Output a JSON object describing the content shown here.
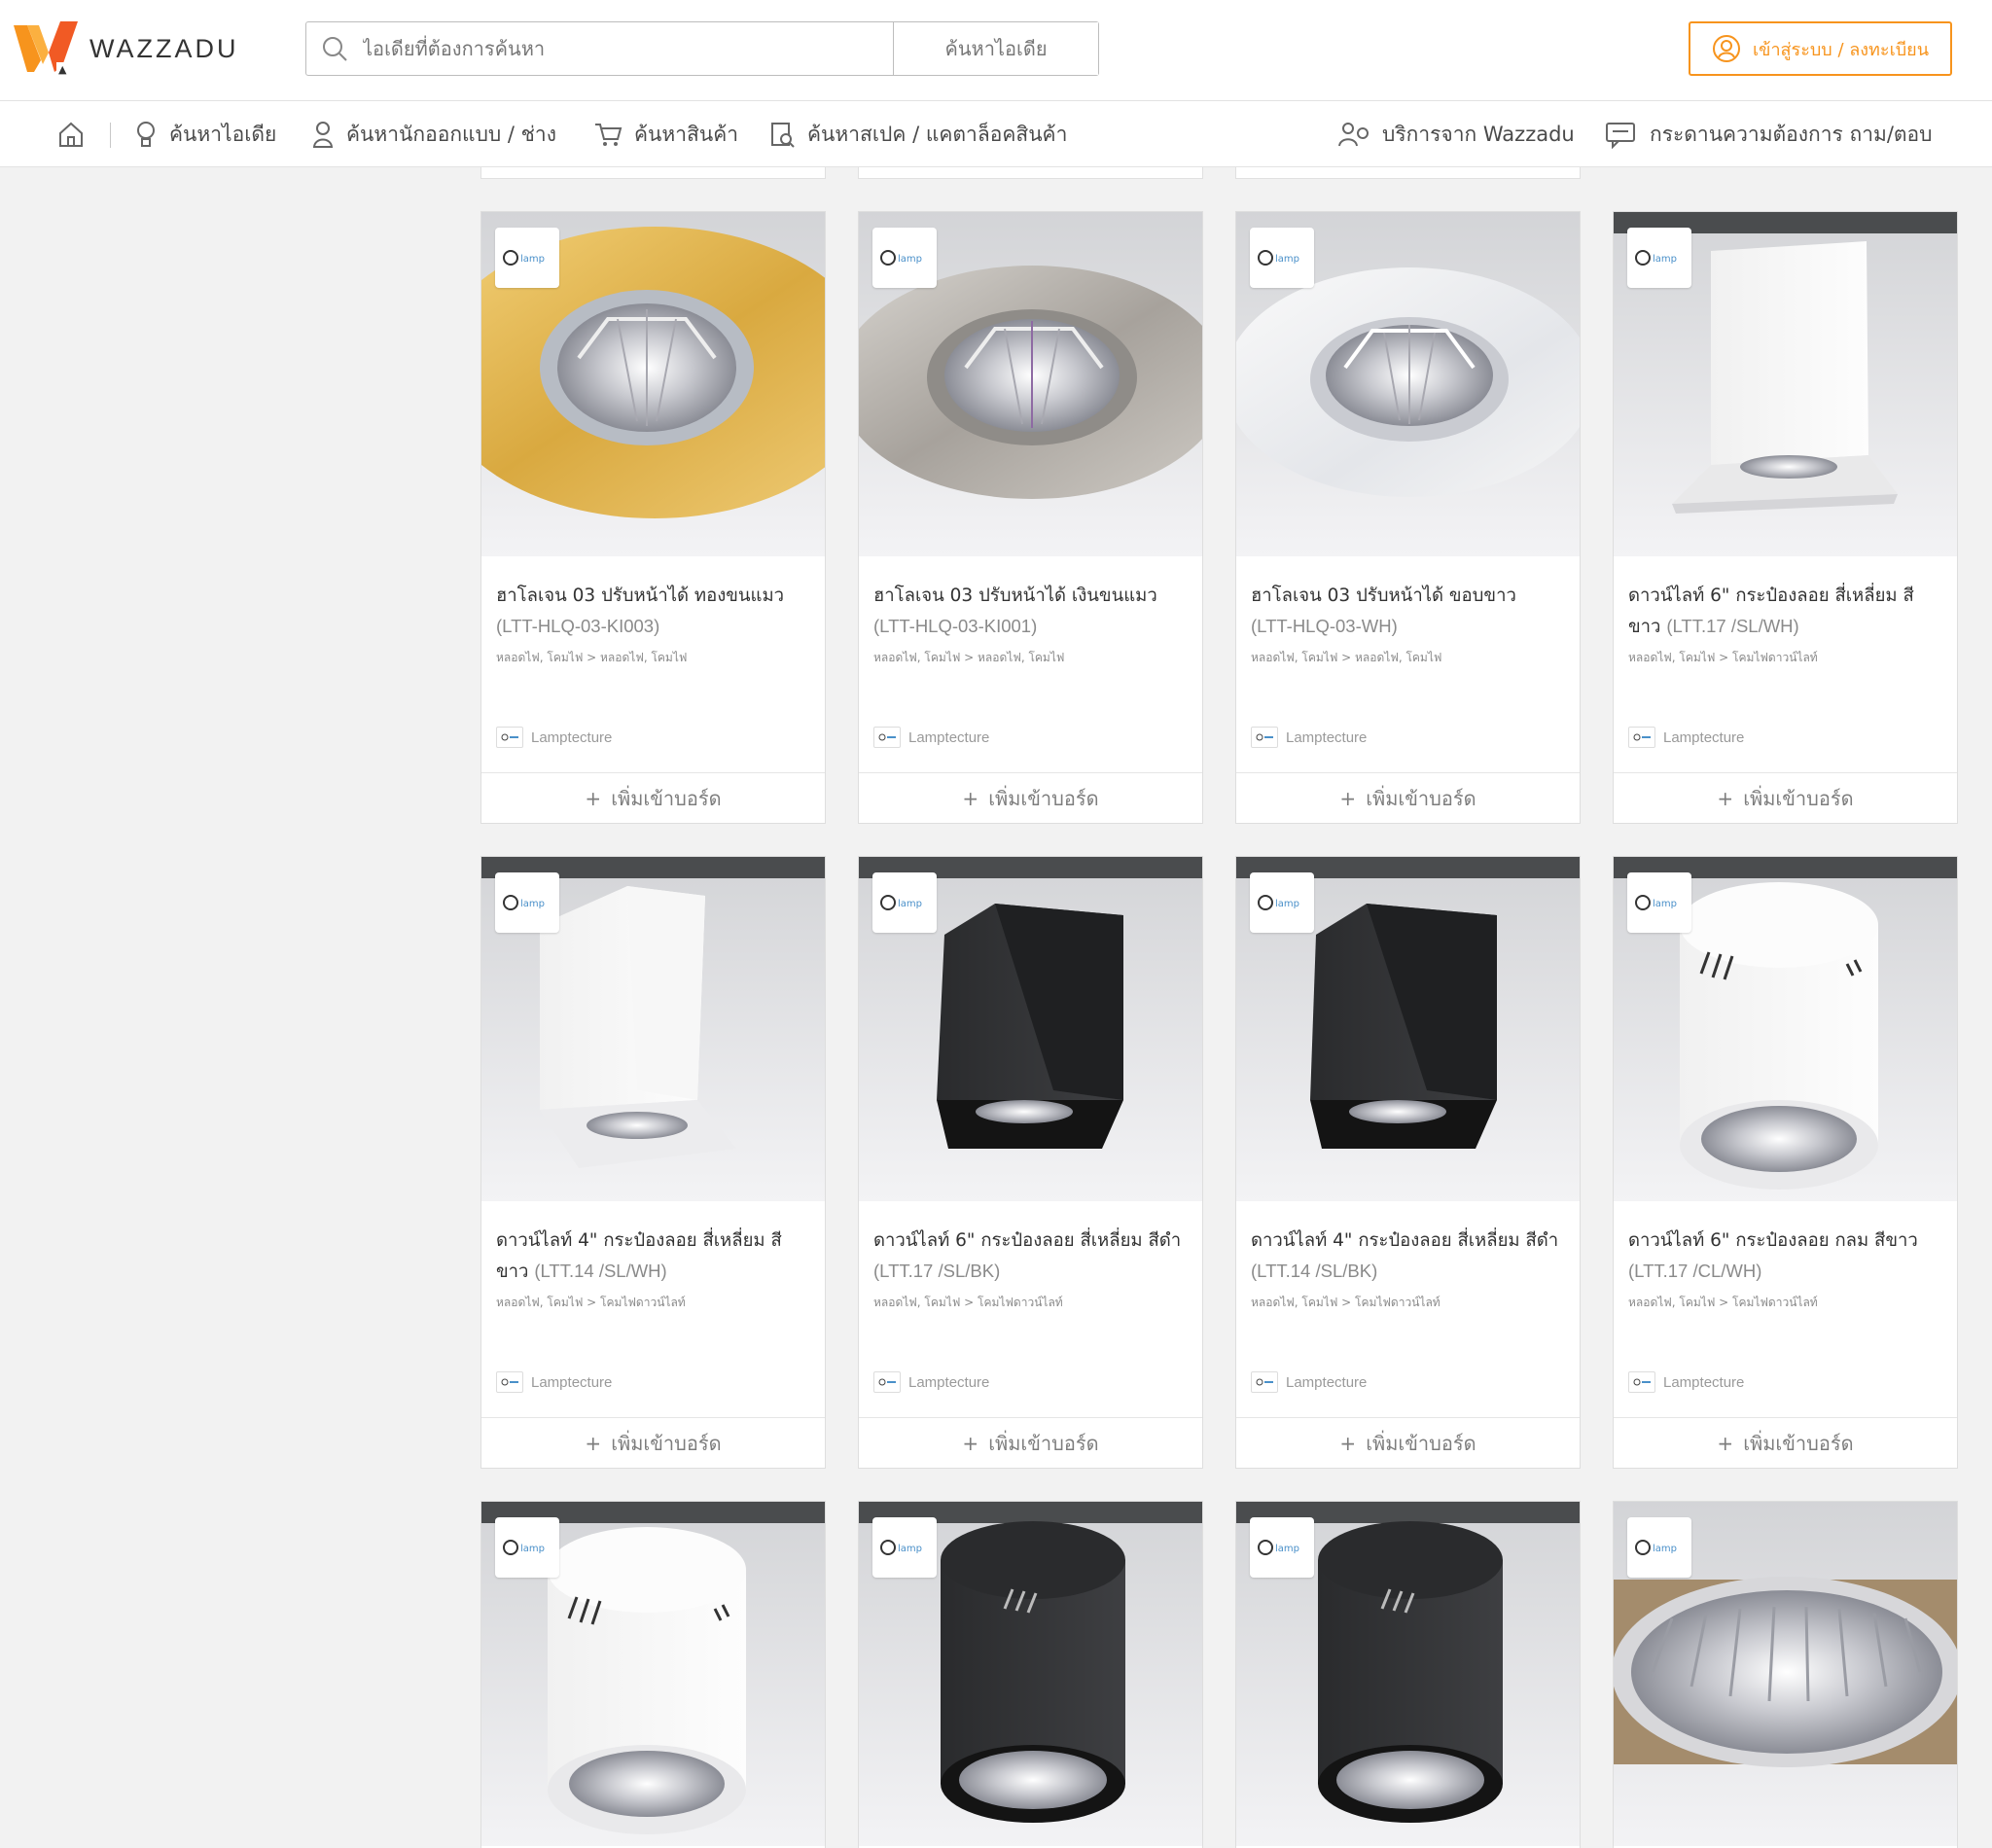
{
  "header": {
    "logo_text": "WAZZADU",
    "search_placeholder": "ไอเดียที่ต้องการค้นหา",
    "search_button": "ค้นหาไอเดีย",
    "login_button": "เข้าสู่ระบบ / ลงทะเบียน",
    "accent_color": "#f7941d"
  },
  "nav": {
    "items": [
      {
        "label": "ค้นหาไอเดีย",
        "icon": "lightbulb-icon"
      },
      {
        "label": "ค้นหานักออกแบบ / ช่าง",
        "icon": "person-icon"
      },
      {
        "label": "ค้นหาสินค้า",
        "icon": "cart-icon"
      },
      {
        "label": "ค้นหาสเปค / แคตาล็อคสินค้า",
        "icon": "catalog-icon"
      },
      {
        "label": "บริการจาก Wazzadu",
        "icon": "service-icon"
      },
      {
        "label": "กระดานความต้องการ ถาม/ตอบ",
        "icon": "message-board-icon"
      }
    ],
    "home_icon": "home-icon"
  },
  "products": [
    {
      "title": "ฮาโลเจน 03 ปรับหน้าได้ ทองขนแมว",
      "code": "(LTT-HLQ-03-KI003)",
      "category": "หลอดไฟ, โคมไฟ > หลอดไฟ, โคมไฟ",
      "brand": "Lamptecture",
      "add_label": "เพิ่มเข้าบอร์ด"
    },
    {
      "title": "ฮาโลเจน 03 ปรับหน้าได้ เงินขนแมว",
      "code": "(LTT-HLQ-03-KI001)",
      "category": "หลอดไฟ, โคมไฟ > หลอดไฟ, โคมไฟ",
      "brand": "Lamptecture",
      "add_label": "เพิ่มเข้าบอร์ด"
    },
    {
      "title": "ฮาโลเจน 03 ปรับหน้าได้ ขอบขาว",
      "code": "(LTT-HLQ-03-WH)",
      "category": "หลอดไฟ, โคมไฟ > หลอดไฟ, โคมไฟ",
      "brand": "Lamptecture",
      "add_label": "เพิ่มเข้าบอร์ด"
    },
    {
      "title": "ดาวน์ไลท์ 6\" กระป๋องลอย สี่เหลี่ยม สีขาว",
      "code": "(LTT.17 /SL/WH)",
      "category": "หลอดไฟ, โคมไฟ > โคมไฟดาวน์ไลท์",
      "brand": "Lamptecture",
      "add_label": "เพิ่มเข้าบอร์ด"
    },
    {
      "title": "ดาวน์ไลท์ 4\" กระป๋องลอย สี่เหลี่ยม สีขาว",
      "code": "(LTT.14 /SL/WH)",
      "category": "หลอดไฟ, โคมไฟ > โคมไฟดาวน์ไลท์",
      "brand": "Lamptecture",
      "add_label": "เพิ่มเข้าบอร์ด"
    },
    {
      "title": "ดาวน์ไลท์ 6\" กระป๋องลอย สี่เหลี่ยม สีดำ",
      "code": "(LTT.17 /SL/BK)",
      "category": "หลอดไฟ, โคมไฟ > โคมไฟดาวน์ไลท์",
      "brand": "Lamptecture",
      "add_label": "เพิ่มเข้าบอร์ด"
    },
    {
      "title": "ดาวน์ไลท์ 4\" กระป๋องลอย สี่เหลี่ยม สีดำ",
      "code": "(LTT.14 /SL/BK)",
      "category": "หลอดไฟ, โคมไฟ > โคมไฟดาวน์ไลท์",
      "brand": "Lamptecture",
      "add_label": "เพิ่มเข้าบอร์ด"
    },
    {
      "title": "ดาวน์ไลท์ 6\" กระป๋องลอย กลม สีขาว",
      "code": "(LTT.17 /CL/WH)",
      "category": "หลอดไฟ, โคมไฟ > โคมไฟดาวน์ไลท์",
      "brand": "Lamptecture",
      "add_label": "เพิ่มเข้าบอร์ด"
    }
  ]
}
